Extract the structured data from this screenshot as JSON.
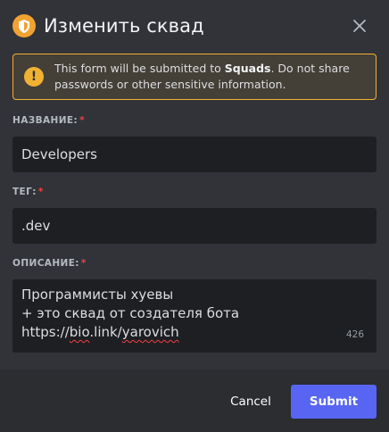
{
  "header": {
    "title": "Изменить сквад",
    "app_icon": "shield-icon",
    "close_icon": "close-icon"
  },
  "warning": {
    "icon": "warning-icon",
    "glyph": "!",
    "text_before": "This form will be submitted to ",
    "target": "Squads",
    "text_after": ". Do not share passwords or other sensitive information."
  },
  "fields": {
    "name": {
      "label": "НАЗВАНИЕ:",
      "required": "*",
      "value": "Developers"
    },
    "tag": {
      "label": "ТЕГ:",
      "required": "*",
      "value": ".dev"
    },
    "description": {
      "label": "ОПИСАНИЕ:",
      "required": "*",
      "lines": [
        "Программисты хуевы",
        "+ это сквад от создателя бота"
      ],
      "link_prefix": "https://",
      "link_domain": "bio",
      "link_mid": ".link/",
      "link_user": "yarovich",
      "counter": "426"
    }
  },
  "footer": {
    "cancel_label": "Cancel",
    "submit_label": "Submit"
  },
  "colors": {
    "accent": "#5865f2",
    "warning": "#f0b232",
    "required": "#f23f43",
    "app_icon": "#f0a232"
  }
}
